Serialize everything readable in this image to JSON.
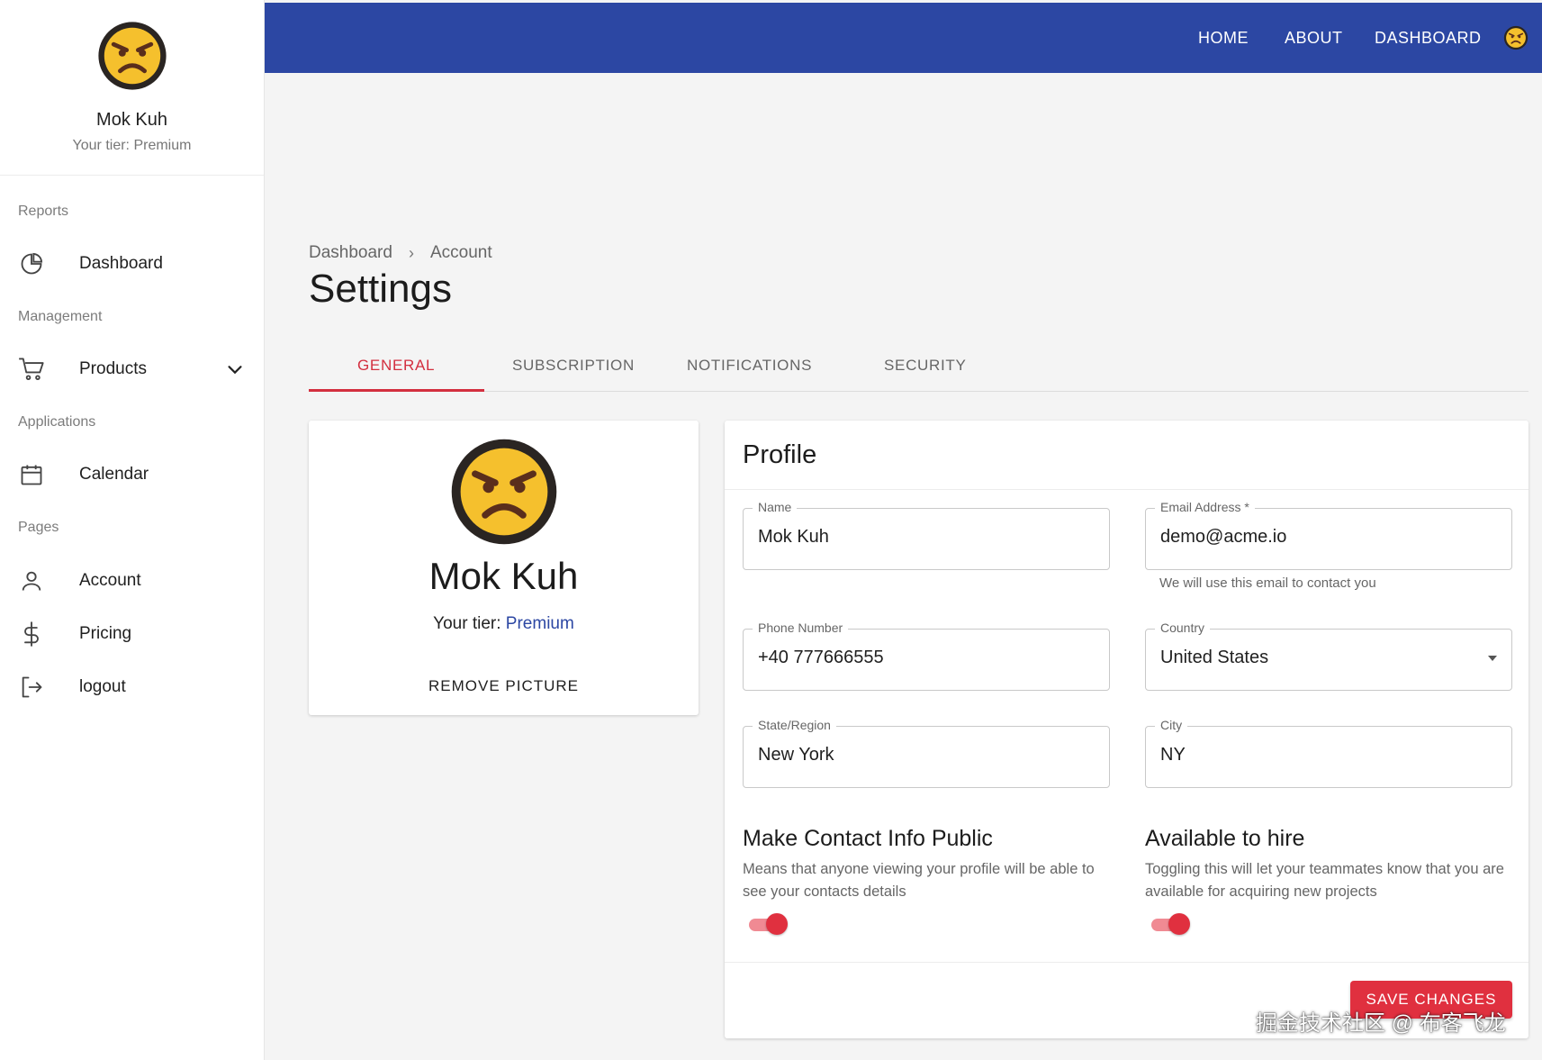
{
  "sidebar": {
    "user": {
      "name": "Mok Kuh",
      "tier": "Your tier: Premium"
    },
    "sections": {
      "reports": "Reports",
      "management": "Management",
      "applications": "Applications",
      "pages": "Pages"
    },
    "items": {
      "dashboard": "Dashboard",
      "products": "Products",
      "calendar": "Calendar",
      "account": "Account",
      "pricing": "Pricing",
      "logout": "logout"
    }
  },
  "topbar": {
    "nav": [
      "HOME",
      "ABOUT",
      "DASHBOARD"
    ]
  },
  "breadcrumb": {
    "parent": "Dashboard",
    "current": "Account"
  },
  "page_title": "Settings",
  "tabs": [
    "GENERAL",
    "SUBSCRIPTION",
    "NOTIFICATIONS",
    "SECURITY"
  ],
  "active_tab": "GENERAL",
  "profile_card": {
    "name": "Mok Kuh",
    "tier_label": "Your tier: ",
    "tier_value": "Premium",
    "remove_label": "REMOVE PICTURE"
  },
  "profile_form": {
    "title": "Profile",
    "name": {
      "label": "Name",
      "value": "Mok Kuh"
    },
    "email": {
      "label": "Email Address *",
      "value": "demo@acme.io",
      "helper": "We will use this email to contact you"
    },
    "phone": {
      "label": "Phone Number",
      "value": "+40 777666555"
    },
    "country": {
      "label": "Country",
      "value": "United States"
    },
    "state": {
      "label": "State/Region",
      "value": "New York"
    },
    "city": {
      "label": "City",
      "value": "NY"
    },
    "contact_public": {
      "title": "Make Contact Info Public",
      "description": "Means that anyone viewing your profile will be able to see your contacts details",
      "enabled": true
    },
    "available_hire": {
      "title": "Available to hire",
      "description": "Toggling this will let your teammates know that you are available for acquiring new projects",
      "enabled": true
    },
    "save_label": "SAVE CHANGES"
  },
  "watermark": "掘金技术社区 @ 布客飞龙",
  "colors": {
    "primary": "#2c47a3",
    "accent": "#e0303f",
    "tab_active": "#d32f3f"
  }
}
